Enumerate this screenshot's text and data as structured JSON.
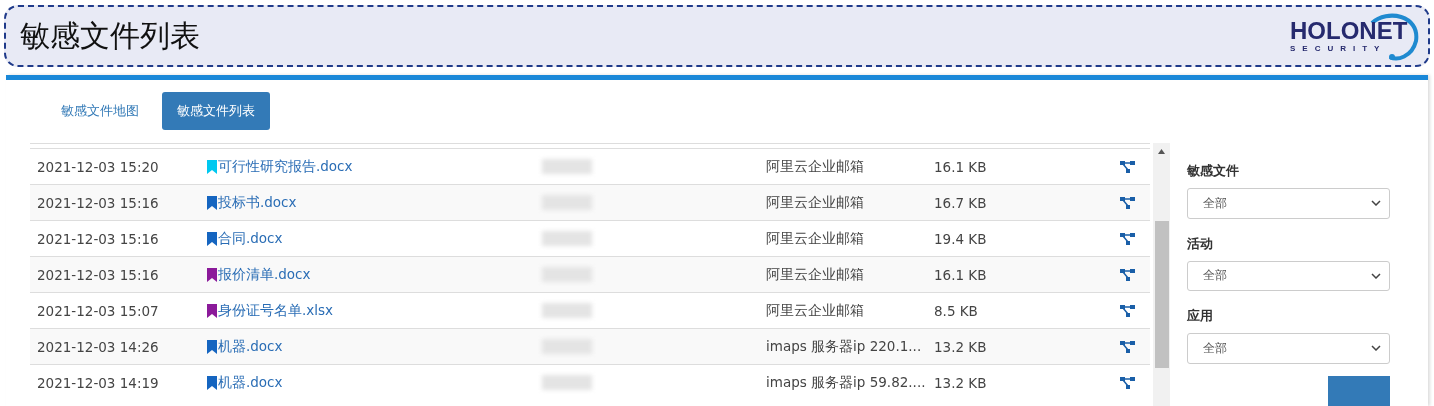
{
  "header": {
    "title": "敏感文件列表",
    "logo": {
      "name": "HOLONET",
      "tagline": "SECURITY"
    }
  },
  "tabs": [
    {
      "label": "敏感文件地图",
      "selected": false
    },
    {
      "label": "敏感文件列表",
      "selected": true
    }
  ],
  "table": {
    "rows": [
      {
        "time": "2021-12-03 15:20",
        "file": "可行性研究报告.docx",
        "color": "#00c8f0",
        "app": "阿里云企业邮箱",
        "size": "16.1 KB"
      },
      {
        "time": "2021-12-03 15:16",
        "file": "投标书.docx",
        "color": "#1565c0",
        "app": "阿里云企业邮箱",
        "size": "16.7 KB"
      },
      {
        "time": "2021-12-03 15:16",
        "file": "合同.docx",
        "color": "#1565c0",
        "app": "阿里云企业邮箱",
        "size": "19.4 KB"
      },
      {
        "time": "2021-12-03 15:16",
        "file": "报价清单.docx",
        "color": "#8b1a9a",
        "app": "阿里云企业邮箱",
        "size": "16.1 KB"
      },
      {
        "time": "2021-12-03 15:07",
        "file": "身份证号名单.xlsx",
        "color": "#8b1a9a",
        "app": "阿里云企业邮箱",
        "size": "8.5 KB"
      },
      {
        "time": "2021-12-03 14:26",
        "file": "机器.docx",
        "color": "#1565c0",
        "app": "imaps 服务器ip 220.1...",
        "size": "13.2 KB"
      },
      {
        "time": "2021-12-03 14:19",
        "file": "机器.docx",
        "color": "#1565c0",
        "app": "imaps 服务器ip 59.82....",
        "size": "13.2 KB"
      }
    ]
  },
  "filters": [
    {
      "label": "敏感文件",
      "value": "全部"
    },
    {
      "label": "活动",
      "value": "全部"
    },
    {
      "label": "应用",
      "value": "全部"
    }
  ]
}
